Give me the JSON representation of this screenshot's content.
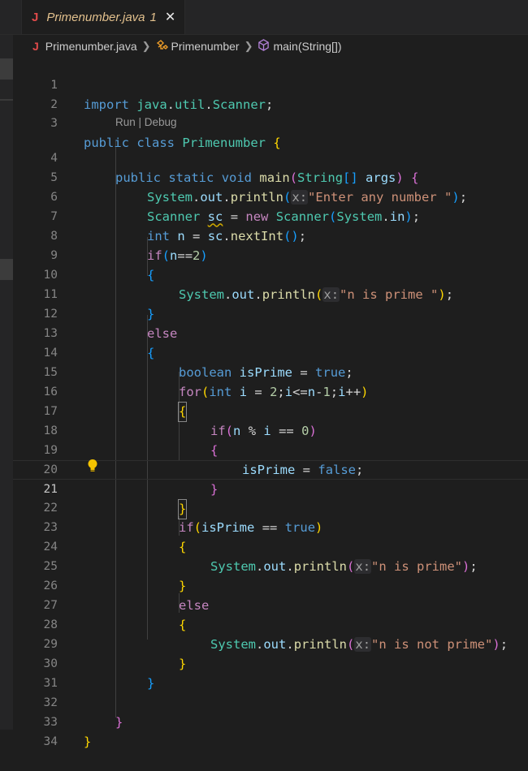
{
  "tab": {
    "icon": "J",
    "filename": "Primenumber.java",
    "problem_count": "1",
    "close": "✕"
  },
  "breadcrumb": {
    "file_icon": "J",
    "file": "Primenumber.java",
    "class": "Primenumber",
    "method": "main(String[])"
  },
  "codelens": "Run | Debug",
  "active_line": 21,
  "colors": {
    "background": "#1e1e1e",
    "keyword": "#569cd6",
    "control": "#c586c0",
    "type": "#4ec9b0",
    "variable": "#9cdcfe",
    "function": "#dcdcaa",
    "string": "#ce9178",
    "number": "#b5cea8"
  },
  "lines": [
    {
      "n": "1"
    },
    {
      "n": "2"
    },
    {
      "n": "3"
    },
    {
      "n": "4"
    },
    {
      "n": "5"
    },
    {
      "n": "6"
    },
    {
      "n": "7"
    },
    {
      "n": "8"
    },
    {
      "n": "9"
    },
    {
      "n": "10"
    },
    {
      "n": "11"
    },
    {
      "n": "12"
    },
    {
      "n": "13"
    },
    {
      "n": "14"
    },
    {
      "n": "15"
    },
    {
      "n": "16"
    },
    {
      "n": "17"
    },
    {
      "n": "18"
    },
    {
      "n": "19"
    },
    {
      "n": "20"
    },
    {
      "n": "21"
    },
    {
      "n": "22"
    },
    {
      "n": "23"
    },
    {
      "n": "24"
    },
    {
      "n": "25"
    },
    {
      "n": "26"
    },
    {
      "n": "27"
    },
    {
      "n": "28"
    },
    {
      "n": "29"
    },
    {
      "n": "30"
    },
    {
      "n": "31"
    },
    {
      "n": "32"
    },
    {
      "n": "33"
    },
    {
      "n": "34"
    }
  ],
  "code": {
    "l1": "import java.util.Scanner;",
    "l3": "public class Primenumber {",
    "l4": "public static void main(String[] args) {",
    "l5": "System.out.println(x:\"Enter any number \");",
    "l6": "Scanner sc = new Scanner(System.in);",
    "l7": "int n = sc.nextInt();",
    "l8": "if(n==2)",
    "l9": "{",
    "l10": "System.out.println(x:\"n is prime \");",
    "l11": "}",
    "l12": "else",
    "l13": "{",
    "l14": "boolean isPrime = true;",
    "l15": "for(int i = 2;i<=n-1;i++)",
    "l16": "{",
    "l17": "if(n % i == 0)",
    "l18": "{",
    "l19": "isPrime = false;",
    "l20": "}",
    "l21": "}",
    "l22": "if(isPrime == true)",
    "l23": "{",
    "l24": "System.out.println(x:\"n is prime\");",
    "l25": "}",
    "l26": "else",
    "l27": "{",
    "l28": "System.out.println(x:\"n is not prime\");",
    "l29": "}",
    "l30": "}",
    "l32": "}",
    "l33": "}"
  },
  "tokens": {
    "import": "import",
    "pkg1": "java",
    "pkg2": "util",
    "scanner_cls": "Scanner",
    "public": "public",
    "class": "class",
    "class_name": "Primenumber",
    "static": "static",
    "void": "void",
    "main": "main",
    "string_t": "String",
    "args": "args",
    "system": "System",
    "out": "out",
    "println": "println",
    "hint_x": "x:",
    "str_enter": "\"Enter any number \"",
    "sc": "sc",
    "new": "new",
    "in": "in",
    "int": "int",
    "n": "n",
    "nextInt": "nextInt",
    "if": "if",
    "two": "2",
    "str_prime_sp": "\"n is prime \"",
    "else": "else",
    "boolean": "boolean",
    "isPrime": "isPrime",
    "true": "true",
    "for": "for",
    "i": "i",
    "one": "1",
    "zero": "0",
    "false": "false",
    "str_prime": "\"n is prime\"",
    "str_not_prime": "\"n is not prime\""
  }
}
